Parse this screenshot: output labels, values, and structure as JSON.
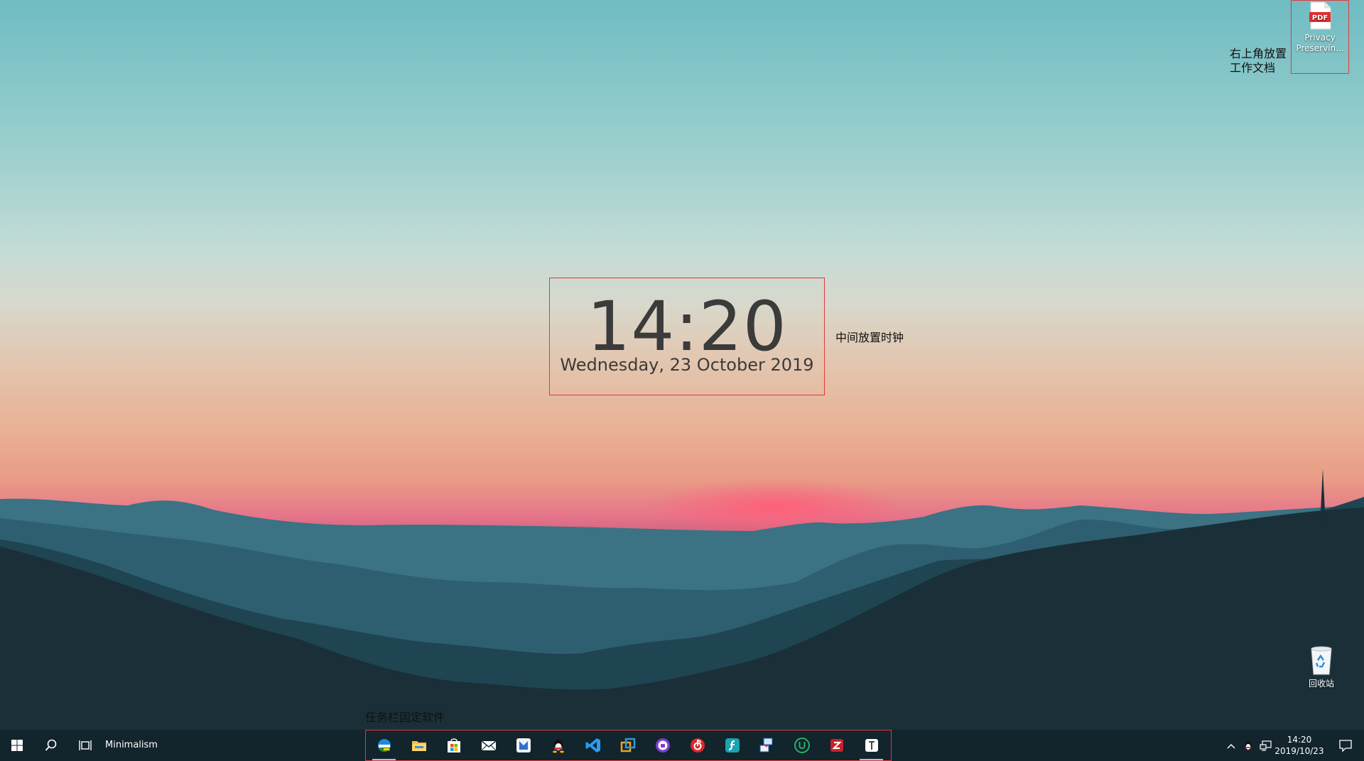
{
  "desktop": {
    "clock": {
      "time": "14:20",
      "date": "Wednesday, 23 October 2019"
    },
    "annotations": {
      "clock_note": "中间放置时钟",
      "doc_note_line1": "右上角放置",
      "doc_note_line2": "工作文档",
      "taskbar_note": "任务栏固定软件"
    },
    "icons": {
      "pdf": {
        "badge": "PDF",
        "label_line1": "Privacy",
        "label_line2": "Preservin..."
      },
      "recycle": {
        "label": "回收站"
      }
    }
  },
  "taskbar": {
    "toolbar_label": "Minimalism",
    "pinned": [
      {
        "name": "ie-browser-icon"
      },
      {
        "name": "file-explorer-icon"
      },
      {
        "name": "store-icon"
      },
      {
        "name": "mail-icon"
      },
      {
        "name": "app-icon"
      },
      {
        "name": "qq-icon"
      },
      {
        "name": "vscode-icon"
      },
      {
        "name": "vmware-icon"
      },
      {
        "name": "media-player-icon"
      },
      {
        "name": "netease-music-icon"
      },
      {
        "name": "sf-icon"
      },
      {
        "name": "network-tool-icon"
      },
      {
        "name": "u-icon"
      },
      {
        "name": "red-app-icon"
      },
      {
        "name": "typora-icon"
      }
    ],
    "tray": {
      "time": "14:20",
      "date": "2019/10/23"
    }
  },
  "colors": {
    "annotation_border": "#e03a3a",
    "clock_text": "#3b3b3b"
  }
}
